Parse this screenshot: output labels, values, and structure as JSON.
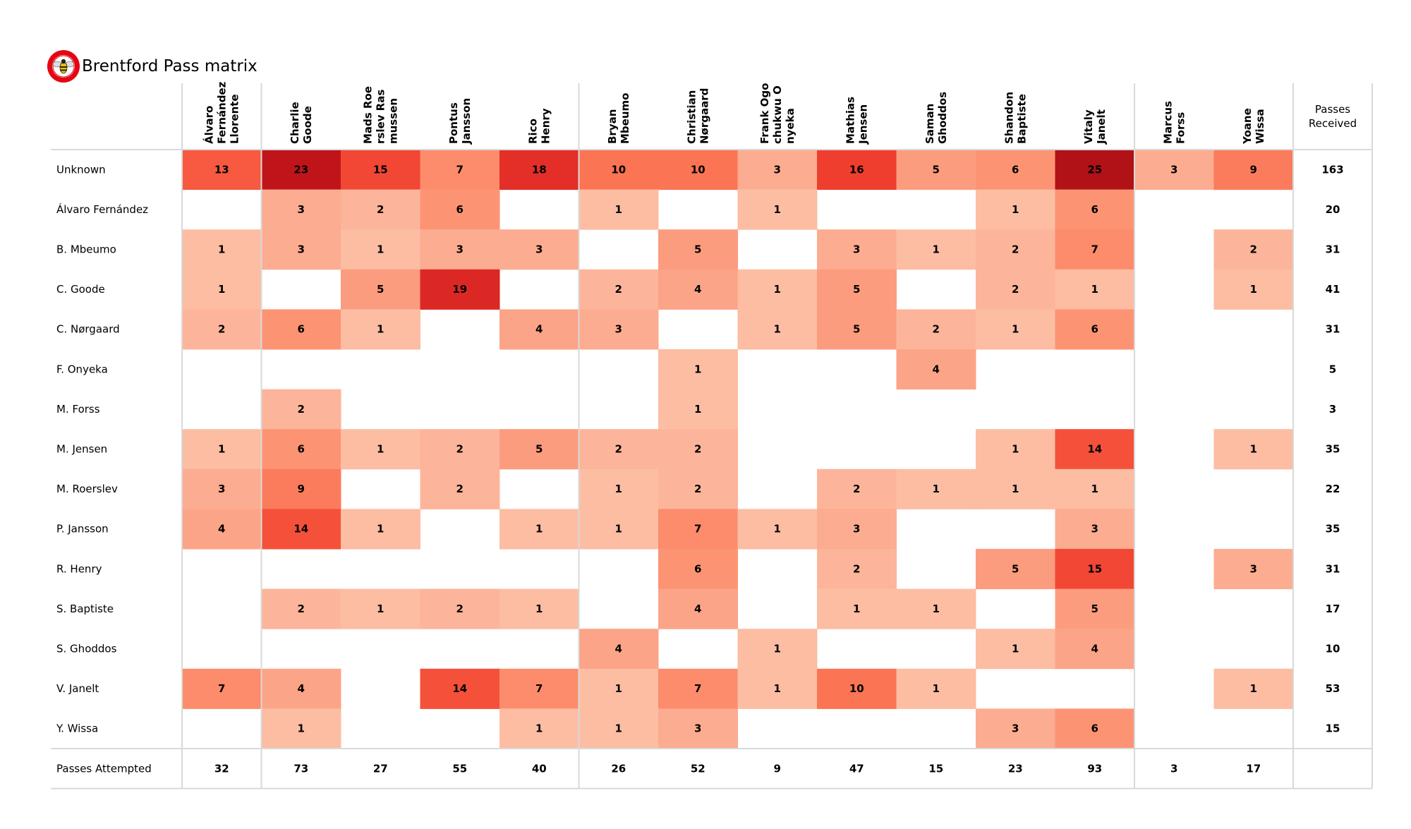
{
  "title": "Brentford Pass matrix",
  "logo": "brentford-crest-icon",
  "chart_data": {
    "type": "heatmap",
    "title": "Brentford Pass matrix",
    "colormap": "Reds",
    "value_range": [
      0,
      25
    ],
    "columns_header": "receiver",
    "rows_header": "passer",
    "columns": [
      [
        "Álvaro",
        "Fernández",
        "Llorente"
      ],
      [
        "Charlie",
        "Goode"
      ],
      [
        "Mads Roe",
        "rslev Ras",
        "mussen"
      ],
      [
        "Pontus",
        "Jansson"
      ],
      [
        "Rico",
        "Henry"
      ],
      [
        "Bryan",
        "Mbeumo"
      ],
      [
        "Christian",
        "Nørgaard"
      ],
      [
        "Frank Ogo",
        "chukwu O",
        "nyeka"
      ],
      [
        "Mathias",
        "Jensen"
      ],
      [
        "Saman",
        "Ghoddos"
      ],
      [
        "Shandon",
        "Baptiste"
      ],
      [
        "Vitaly",
        "Janelt"
      ],
      [
        "Marcus",
        "Forss"
      ],
      [
        "Yoane",
        "Wissa"
      ]
    ],
    "totals_column_label": [
      "Passes",
      "Received"
    ],
    "totals_row_label": "Passes Attempted",
    "rows": [
      {
        "label": "Unknown",
        "values": [
          13,
          23,
          15,
          7,
          18,
          10,
          10,
          3,
          16,
          5,
          6,
          25,
          3,
          9
        ],
        "received": 163
      },
      {
        "label": "Álvaro Fernández",
        "values": [
          null,
          3,
          2,
          6,
          null,
          1,
          null,
          1,
          null,
          null,
          1,
          6,
          null,
          null
        ],
        "received": 20
      },
      {
        "label": "B. Mbeumo",
        "values": [
          1,
          3,
          1,
          3,
          3,
          null,
          5,
          null,
          3,
          1,
          2,
          7,
          null,
          2
        ],
        "received": 31
      },
      {
        "label": "C. Goode",
        "values": [
          1,
          null,
          5,
          19,
          null,
          2,
          4,
          1,
          5,
          null,
          2,
          1,
          null,
          1
        ],
        "received": 41
      },
      {
        "label": "C. Nørgaard",
        "values": [
          2,
          6,
          1,
          null,
          4,
          3,
          null,
          1,
          5,
          2,
          1,
          6,
          null,
          null
        ],
        "received": 31
      },
      {
        "label": "F. Onyeka",
        "values": [
          null,
          null,
          null,
          null,
          null,
          null,
          1,
          null,
          null,
          4,
          null,
          null,
          null,
          null
        ],
        "received": 5
      },
      {
        "label": "M. Forss",
        "values": [
          null,
          2,
          null,
          null,
          null,
          null,
          1,
          null,
          null,
          null,
          null,
          null,
          null,
          null
        ],
        "received": 3
      },
      {
        "label": "M. Jensen",
        "values": [
          1,
          6,
          1,
          2,
          5,
          2,
          2,
          null,
          null,
          null,
          1,
          14,
          null,
          1
        ],
        "received": 35
      },
      {
        "label": "M. Roerslev",
        "values": [
          3,
          9,
          null,
          2,
          null,
          1,
          2,
          null,
          2,
          1,
          1,
          1,
          null,
          null
        ],
        "received": 22
      },
      {
        "label": "P. Jansson",
        "values": [
          4,
          14,
          1,
          null,
          1,
          1,
          7,
          1,
          3,
          null,
          null,
          3,
          null,
          null
        ],
        "received": 35
      },
      {
        "label": "R. Henry",
        "values": [
          null,
          null,
          null,
          null,
          null,
          null,
          6,
          null,
          2,
          null,
          5,
          15,
          null,
          3
        ],
        "received": 31
      },
      {
        "label": "S. Baptiste",
        "values": [
          null,
          2,
          1,
          2,
          1,
          null,
          4,
          null,
          1,
          1,
          null,
          5,
          null,
          null
        ],
        "received": 17
      },
      {
        "label": "S. Ghoddos",
        "values": [
          null,
          null,
          null,
          null,
          null,
          4,
          null,
          1,
          null,
          null,
          1,
          4,
          null,
          null
        ],
        "received": 10
      },
      {
        "label": "V. Janelt",
        "values": [
          7,
          4,
          null,
          14,
          7,
          1,
          7,
          1,
          10,
          1,
          null,
          null,
          null,
          1
        ],
        "received": 53
      },
      {
        "label": "Y. Wissa",
        "values": [
          null,
          1,
          null,
          null,
          1,
          1,
          3,
          null,
          null,
          null,
          3,
          6,
          null,
          null
        ],
        "received": 15
      }
    ],
    "attempted": [
      32,
      73,
      27,
      55,
      40,
      26,
      52,
      9,
      47,
      15,
      23,
      93,
      3,
      17
    ],
    "grid": false
  }
}
